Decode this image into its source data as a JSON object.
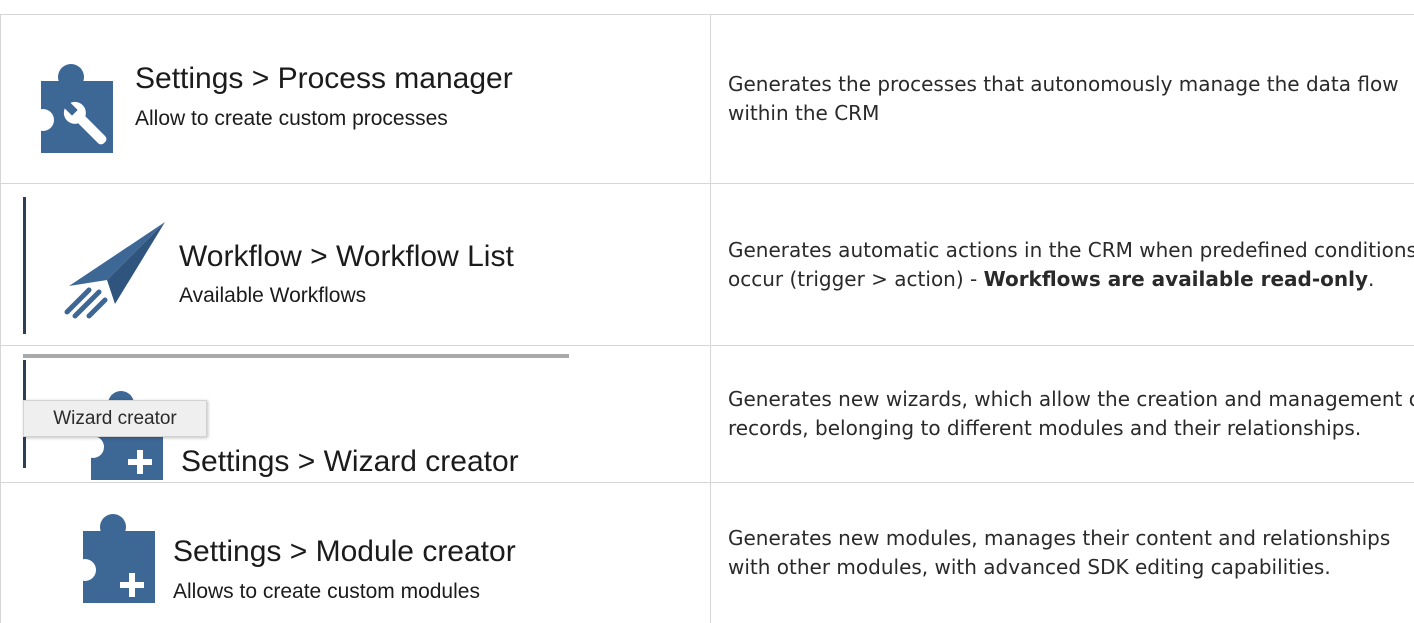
{
  "rows": [
    {
      "screenshot": {
        "title": "Settings > Process manager",
        "subtitle": "Allow to create custom processes",
        "icon": "puzzle-wrench-icon"
      },
      "description": "Generates the processes that autonomously manage the data flow within the CRM"
    },
    {
      "screenshot": {
        "title": "Workflow > Workflow List",
        "subtitle": "Available Workflows",
        "icon": "paper-plane-icon"
      },
      "description_plain": "Generates automatic actions in the CRM when predefined conditions occur (trigger > action) - ",
      "description_bold": "Workflows are available read-only",
      "description_end": "."
    },
    {
      "screenshot": {
        "title": "Settings > Wizard creator",
        "tooltip": "Wizard creator",
        "icon": "puzzle-plus-icon"
      },
      "description": "Generates new wizards, which allow the creation and management of records, belonging to different modules and their relationships."
    },
    {
      "screenshot": {
        "title": "Settings > Module creator",
        "subtitle": "Allows to create custom modules",
        "icon": "puzzle-plus-icon"
      },
      "description": "Generates new modules, manages their content and relationships with other modules, with advanced SDK editing capabilities."
    }
  ],
  "colors": {
    "icon_blue": "#3d6795",
    "border": "#d6d6d6",
    "text": "#2a2a2a"
  }
}
